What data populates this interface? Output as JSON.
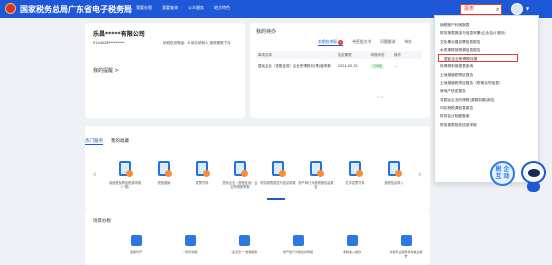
{
  "header": {
    "title": "国家税务总局广东省电子税务局",
    "nav_items": [
      "首页",
      "我要办税",
      "我要查询",
      "公众服务",
      "地方特色"
    ],
    "search_value": "报表",
    "search_icon": "search-icon",
    "avatar_icon": "avatar-icon",
    "caret_icon": "chevron-down-icon"
  },
  "company_card": {
    "name": "乐昌*****有限公司",
    "tax_id": "9144028*********",
    "info": "纳税信用等级：B   新办纳税人  报税期限下月",
    "reminder": "我的提醒 >"
  },
  "todo": {
    "title": "我的待办",
    "tabs": [
      "本期应申报",
      "待签批文书",
      "问题跟进",
      "待办"
    ],
    "badge": "1",
    "headers": [
      "事项名称",
      "法定期限",
      "申报状态",
      "操作"
    ],
    "row": {
      "name": "居民企业（查账征收）企业所得税月(季)度申报",
      "date": "2024-05-31",
      "status": "已申报",
      "action": "..."
    },
    "pagination": "1 / 1"
  },
  "menu": {
    "items": [
      "纳税账户利润报表",
      "财务报表报送与信息采集(企业会计准则)",
      "文化事业建设费信息报告",
      "水资源税按税源信息报告",
      "居民企业所得税月报",
      "所得税申报报表查询",
      "土地增值税预征报告",
      "土地增值税项目报告（附报合同信息）",
      "房地产信息报告",
      "非居民企业所得税(源泉扣缴)报告",
      "印花税税源信息报告",
      "财务会计制度备案",
      "财务报表相关信息申报"
    ],
    "highlight_index": 4
  },
  "services": {
    "tabs": [
      "热门服务",
      "我的收藏"
    ],
    "items": [
      "增值税及附加税费申报（一般）",
      "税费缴纳",
      "发票开具",
      "居民企业（查账征收）企业所得税季报",
      "财务报表报送与信息采集",
      "财产和行为税税源信息报告",
      "红字发票开具",
      "报税信息录入"
    ],
    "prev_icon": "chevron-left-icon",
    "next_icon": "chevron-right-icon"
  },
  "second_section": {
    "title": "场景办税",
    "items": [
      "发票代开",
      "一照式通税",
      "“多证合一”费税服务",
      "财产和行为税合并申报",
      "非税收入缴款",
      "涉税专业服务机构信息报告"
    ]
  },
  "mascot": {
    "bubble": "税 企 互 动"
  }
}
